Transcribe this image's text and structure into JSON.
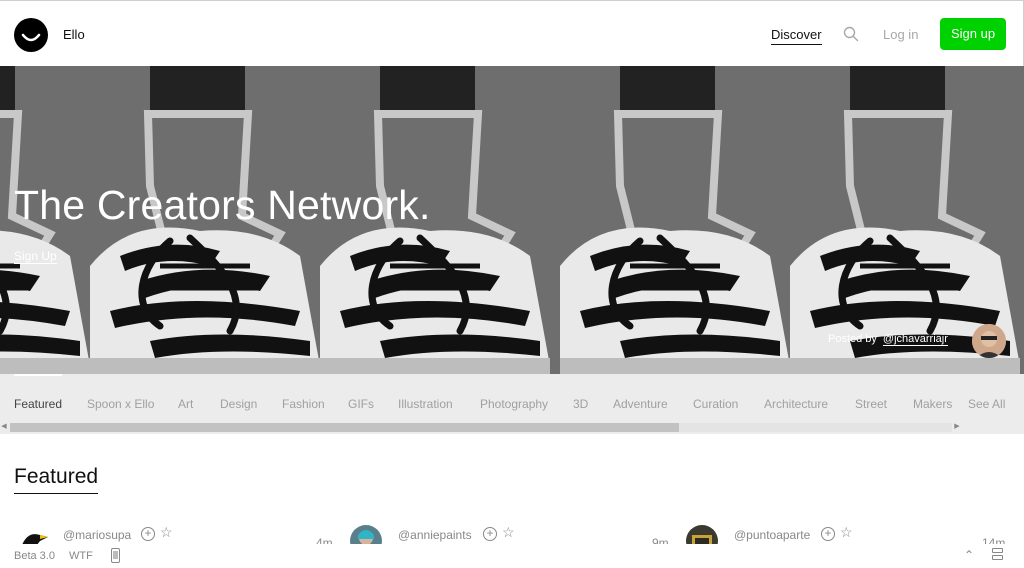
{
  "header": {
    "brand": "Ello",
    "discover": "Discover",
    "login": "Log in",
    "signup": "Sign up"
  },
  "hero": {
    "title": "The Creators Network.",
    "signup_link": "Sign Up",
    "posted_by_label": "Posted by",
    "posted_by_handle": "@jchavarriajr"
  },
  "categories": {
    "items": [
      "Featured",
      "Spoon x Ello",
      "Art",
      "Design",
      "Fashion",
      "GIFs",
      "Illustration",
      "Photography",
      "3D",
      "Adventure",
      "Curation",
      "Architecture",
      "Street",
      "Makers"
    ],
    "active": "Featured",
    "see_all": "See All",
    "scroll_position_fraction": 0.0,
    "scroll_visible_fraction": 0.71
  },
  "featured": {
    "title": "Featured",
    "posts": [
      {
        "username": "@mariosupa",
        "time": "4m"
      },
      {
        "username": "@anniepaints",
        "time": "9m"
      },
      {
        "username": "@puntoaparte",
        "time": "14m"
      }
    ]
  },
  "footer": {
    "version": "Beta 3.0",
    "wtf": "WTF"
  },
  "colors": {
    "accent_green": "#00d100",
    "hero_gray": "#6e6e6e",
    "category_bar": "#ececec"
  },
  "icons": [
    "logo-smile-icon",
    "search-icon",
    "follow-plus-icon",
    "star-icon",
    "phone-icon",
    "chevron-up-icon",
    "grid-toggle-icon"
  ]
}
